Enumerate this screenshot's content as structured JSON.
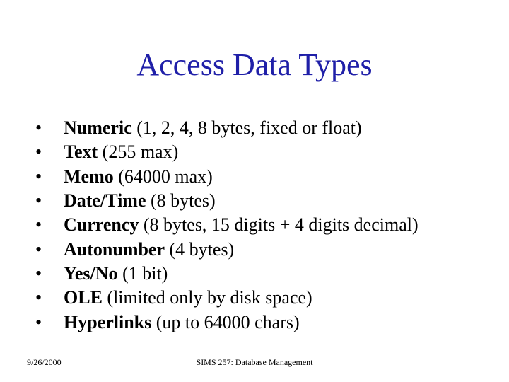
{
  "title": "Access Data Types",
  "bullets": [
    {
      "name": "Numeric",
      "detail": " (1, 2, 4, 8 bytes, fixed or float)"
    },
    {
      "name": "Text",
      "detail": " (255 max)"
    },
    {
      "name": "Memo",
      "detail": " (64000 max)"
    },
    {
      "name": "Date/Time",
      "detail": " (8 bytes)"
    },
    {
      "name": "Currency",
      "detail": " (8 bytes, 15 digits + 4 digits decimal)"
    },
    {
      "name": "Autonumber",
      "detail": " (4 bytes)"
    },
    {
      "name": "Yes/No",
      "detail": " (1 bit)"
    },
    {
      "name": "OLE",
      "detail": " (limited only by disk space)"
    },
    {
      "name": "Hyperlinks",
      "detail": " (up to 64000 chars)"
    }
  ],
  "footer": {
    "date": "9/26/2000",
    "course": "SIMS 257: Database Management"
  }
}
